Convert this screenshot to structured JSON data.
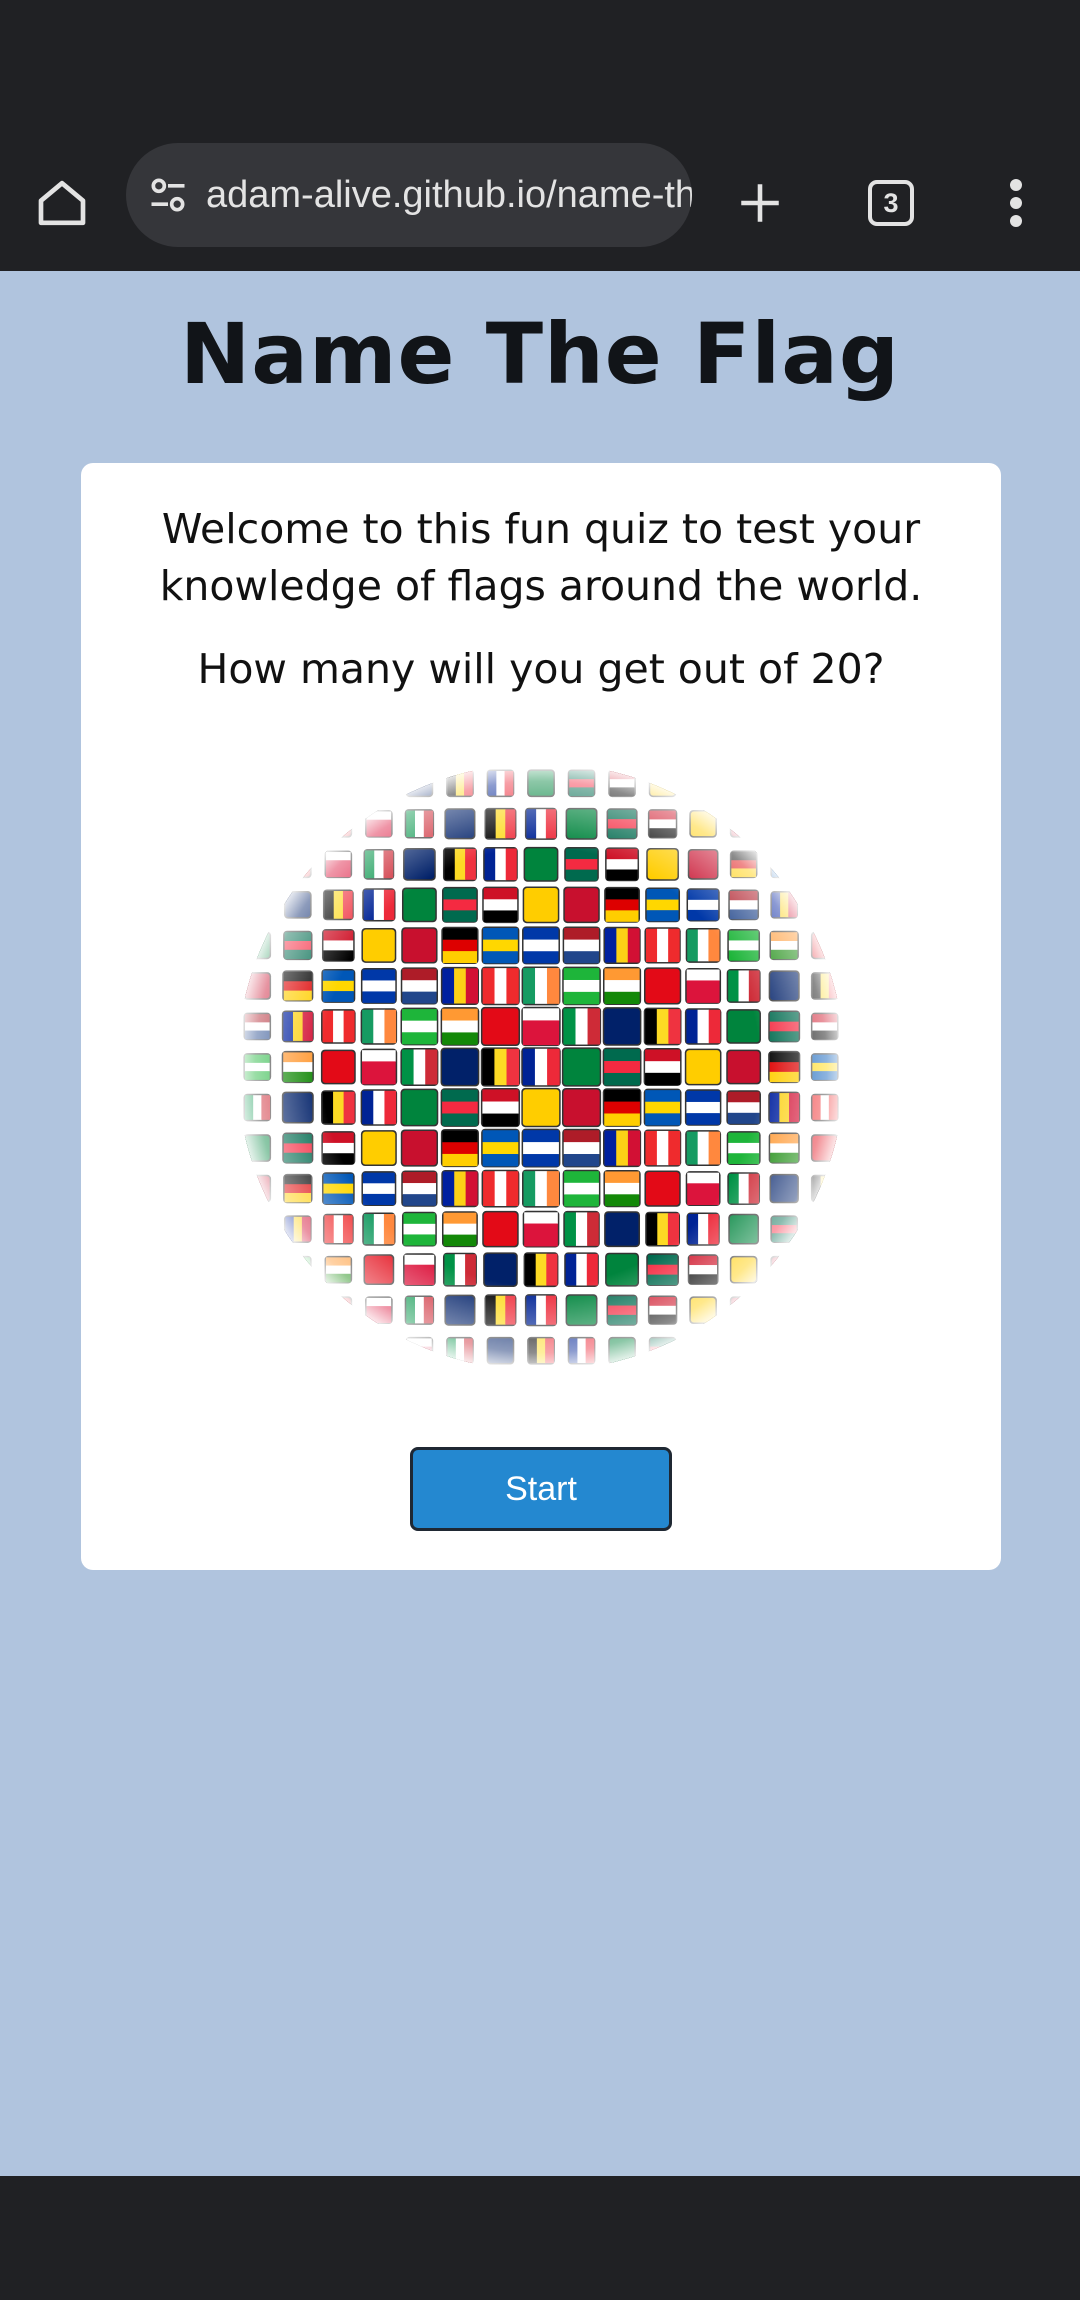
{
  "browser": {
    "url": "adam-alive.github.io/name-the-flag/",
    "tab_count": "3",
    "icons": {
      "home": "home-icon",
      "site_settings": "tune-icon",
      "new_tab": "plus-icon",
      "tabs": "tab-switcher-icon",
      "menu": "more-vert-icon"
    }
  },
  "page": {
    "title": "Name The Flag",
    "welcome_text": "Welcome to this fun quiz to test your knowledge of flags around the world.",
    "question_text": "How many will you get out of 20?",
    "start_label": "Start"
  },
  "colors": {
    "page_background": "#b0c4de",
    "card_background": "#ffffff",
    "start_button": "#2488d0",
    "title_text": "#111418"
  }
}
